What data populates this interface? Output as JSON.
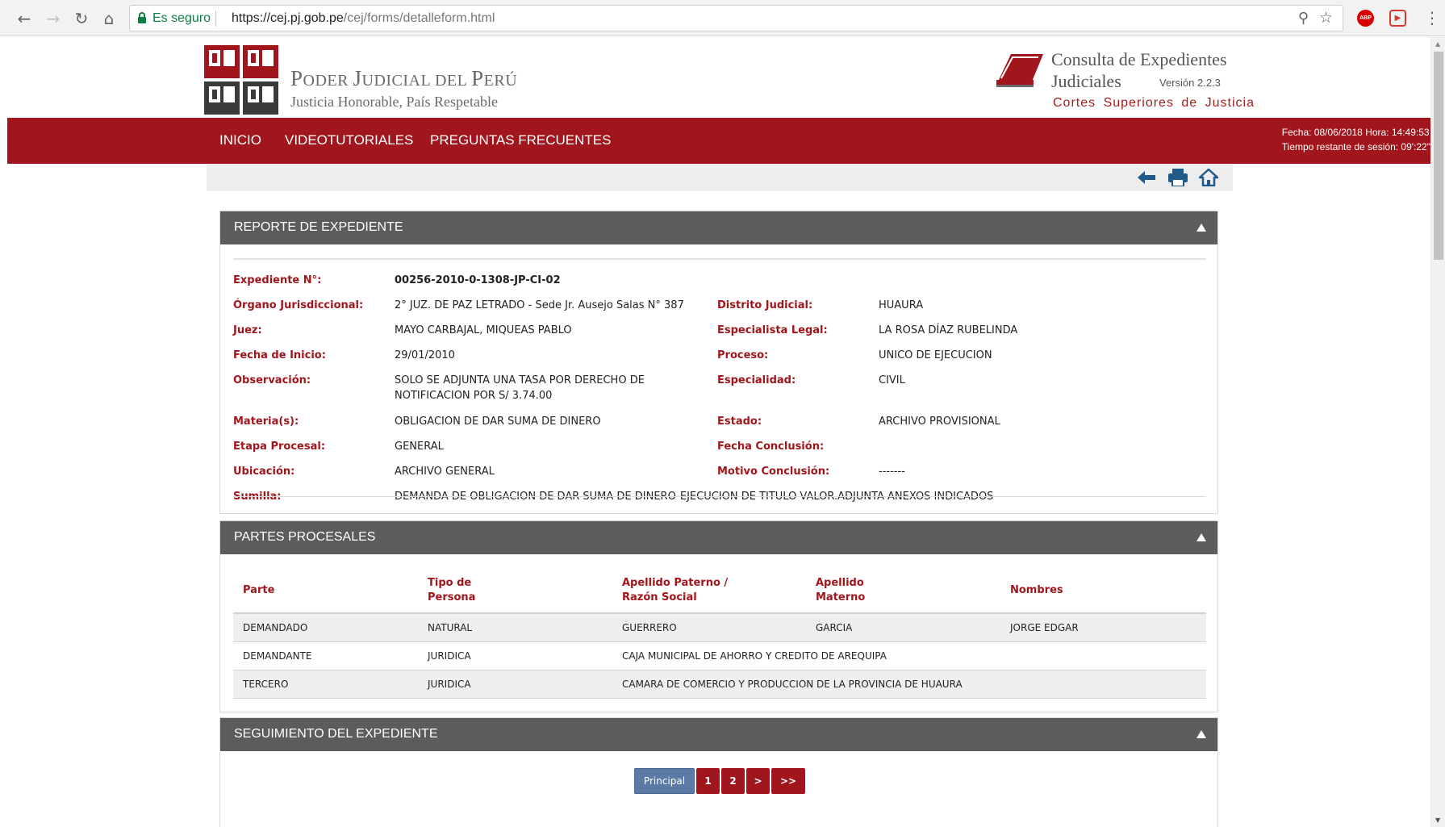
{
  "browser": {
    "secure_label": "Es seguro",
    "url_host": "https://cej.pj.gob.pe",
    "url_path": "/cej/forms/detalleform.html",
    "extensions": [
      "adblock-plus-icon",
      "extension-icon"
    ]
  },
  "header": {
    "org_title_parts": [
      "P",
      "ODER ",
      "J",
      "UDICIAL DEL ",
      "P",
      "ERÚ"
    ],
    "org_slogan": "Justicia Honorable, País Respetable",
    "app_title_line1": "Consulta de Expedientes",
    "app_title_line2": "Judiciales",
    "app_version": "Versión 2.2.3",
    "app_subtitle": "Cortes Superiores de Justicia",
    "colors": {
      "brand_red": "#a0161c",
      "panel_gray": "#5c5c5c"
    }
  },
  "nav": {
    "items": [
      "INICIO",
      "VIDEOTUTORIALES",
      "PREGUNTAS FRECUENTES"
    ],
    "datetime": "Fecha: 08/06/2018 Hora: 14:49:53",
    "session": "Tiempo restante de sesión: 09':22\""
  },
  "toolbar": {
    "icons": [
      "back-arrow-icon",
      "print-icon",
      "home-icon"
    ]
  },
  "reporte": {
    "title": "REPORTE DE EXPEDIENTE",
    "expediente_label": "Expediente N°:",
    "expediente_value": "00256-2010-0-1308-JP-CI-02",
    "organo_label": "Órgano Jurisdiccional:",
    "organo_value": "2° JUZ. DE PAZ LETRADO - Sede Jr. Ausejo Salas N° 387",
    "distrito_label": "Distrito Judicial:",
    "distrito_value": "HUAURA",
    "juez_label": "Juez:",
    "juez_value": "MAYO CARBAJAL, MIQUEAS PABLO",
    "especialista_label": "Especialista Legal:",
    "especialista_value": "LA ROSA DÍAZ RUBELINDA",
    "fecha_inicio_label": "Fecha de Inicio:",
    "fecha_inicio_value": "29/01/2010",
    "proceso_label": "Proceso:",
    "proceso_value": "UNICO DE EJECUCION",
    "observacion_label": "Observación:",
    "observacion_value_l1": "SOLO SE ADJUNTA UNA TASA POR DERECHO DE",
    "observacion_value_l2": "NOTIFICACION POR S/ 3.74.00",
    "especialidad_label": "Especialidad:",
    "especialidad_value": "CIVIL",
    "materia_label": "Materia(s):",
    "materia_value": "OBLIGACION DE DAR SUMA DE DINERO",
    "estado_label": "Estado:",
    "estado_value": "ARCHIVO PROVISIONAL",
    "etapa_label": "Etapa Procesal:",
    "etapa_value": "GENERAL",
    "fecha_conclusion_label": "Fecha Conclusión:",
    "fecha_conclusion_value": "",
    "ubicacion_label": "Ubicación:",
    "ubicacion_value": "ARCHIVO GENERAL",
    "motivo_label": "Motivo Conclusión:",
    "motivo_value": "-------",
    "sumilla_label": "Sumilla:",
    "sumilla_value": "DEMANDA DE OBLIGACION DE DAR SUMA DE DINERO-EJECUCION DE TITULO VALOR.ADJUNTA ANEXOS INDICADOS"
  },
  "partes": {
    "title": "PARTES PROCESALES",
    "headers": {
      "parte": "Parte",
      "tipo_l1": "Tipo de",
      "tipo_l2": "Persona",
      "paterno_l1": "Apellido Paterno /",
      "paterno_l2": "Razón Social",
      "materno_l1": "Apellido",
      "materno_l2": "Materno",
      "nombres": "Nombres"
    },
    "rows": [
      [
        "DEMANDADO",
        "NATURAL",
        "GUERRERO",
        "GARCIA",
        "JORGE EDGAR"
      ],
      [
        "DEMANDANTE",
        "JURIDICA",
        "CAJA MUNICIPAL DE AHORRO Y CREDITO DE AREQUIPA",
        "",
        ""
      ],
      [
        "TERCERO",
        "JURIDICA",
        "CAMARA DE COMERCIO Y PRODUCCION DE LA PROVINCIA DE HUAURA",
        "",
        ""
      ]
    ]
  },
  "seguimiento": {
    "title": "SEGUIMIENTO DEL EXPEDIENTE",
    "pager": [
      "Principal",
      "1",
      "2",
      ">",
      ">>"
    ]
  }
}
